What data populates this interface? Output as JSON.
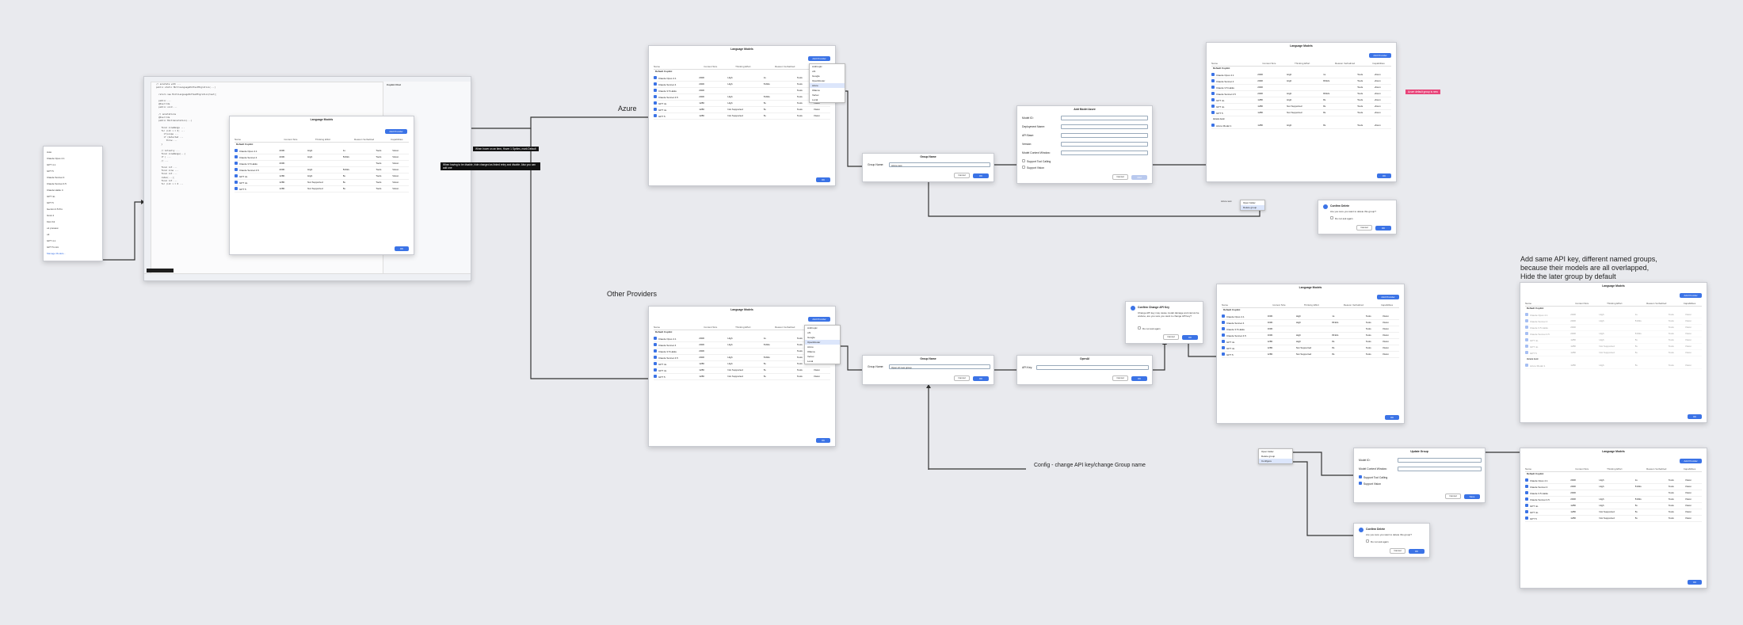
{
  "labels": {
    "azure": "Azure",
    "other_providers": "Other Providers",
    "config_flow": "Config - change API key/change Group name",
    "note": "Add same API key, different named groups,\nbecause their models are all overlapped,\nHide the later group by default",
    "pink_note": "Azure default group is new"
  },
  "dialogs": {
    "language_models": "Language Models",
    "add_model_azure": "Add Model Azure",
    "group_name": "Group Name",
    "openai": "OpenAI",
    "confirm_delete": "Confirm Delete",
    "confirm_change_key": "Confirm Change API Key",
    "update_group": "Update Group",
    "copilot_chat": "Copilot Chat"
  },
  "table": {
    "headers": [
      "Name",
      "Context Size",
      "Thinking Effort",
      "Reason Verbalized",
      "Capabilities"
    ],
    "group_default": "Default Copilot",
    "rows": [
      [
        "Claude Opus 4.1",
        "200K",
        "High",
        "1s",
        "Tools",
        "Vision"
      ],
      [
        "Claude Sonnet 4",
        "200K",
        "High",
        "8192s",
        "Tools",
        "Vision"
      ],
      [
        "Claude 3.5 Haiku",
        "200K",
        "",
        "",
        "Tools",
        "Vision"
      ],
      [
        "Claude Sonnet 4.5",
        "200K",
        "High",
        "8192s",
        "Tools",
        "Vision"
      ],
      [
        "GPT 4o",
        "128K",
        "High",
        "8s",
        "Tools",
        "Vision"
      ],
      [
        "GPT 4o",
        "128K",
        "Not Supported",
        "8s",
        "Tools",
        "Vision"
      ],
      [
        "GPT 5",
        "128K",
        "Not Supported",
        "8s",
        "Tools",
        "Vision"
      ]
    ],
    "group_azure": "Azure test",
    "azure_row": [
      "Azure Model 1",
      "128K",
      "High",
      "8s",
      "Tools",
      "Vision"
    ]
  },
  "buttons": {
    "add_provider": "Add Provider",
    "ok": "OK",
    "cancel": "Cancel",
    "save": "Save",
    "confirm": "Confirm",
    "delete": "Delete",
    "add": "Add"
  },
  "fields": {
    "group_name": "Group Name:",
    "group_value_azure": "Azure test",
    "group_value_other": "Open AI new group",
    "api_key": "API Key:",
    "model_id": "Model ID:",
    "deployment_name": "Deployment Name:",
    "api_base": "API Base:",
    "version": "Version:",
    "model_context": "Model Context Window:",
    "support_tool": "Support Tool Calling",
    "support_vision": "Support Vision"
  },
  "provider_menu": [
    "Anthropic",
    "xAI",
    "Google",
    "OpenRouter",
    "Azure",
    "Ollama",
    "Vertex",
    "Local"
  ],
  "group_menu": [
    "Open folder",
    "Delete group",
    "Configure"
  ],
  "confirm_text": "Are you sure you want to delete this group?",
  "dont_ask": "Do not ask again",
  "change_key_text": "Change API key may cause model damage and cannot be undone, are you sure you want to change API key?",
  "tips": {
    "hover": "When hover on an item, Hover 1 Sprites, mark Default",
    "typing": "When having to be disable, hide changed as linked entry and disable. Also you can add one"
  },
  "sidebar": [
    "Auto",
    "Claude Opus 4.1",
    "GPT 4.1",
    "GPT 5",
    "Claude Sonnet 4",
    "Claude Sonnet 4.5",
    "Claude Haiku 4",
    "GPT 4o",
    "GPT 5",
    "Gemini 2.5 Pro",
    "Grok 4",
    "Kimi K2",
    "o1 preview",
    "o3",
    "GPT 4.1",
    "GPT 5 mini",
    "Manage Models..."
  ],
  "colors": {
    "accent": "#3b73e6",
    "pink": "#e8457a",
    "background": "#e9eaee",
    "line": "#333333"
  }
}
